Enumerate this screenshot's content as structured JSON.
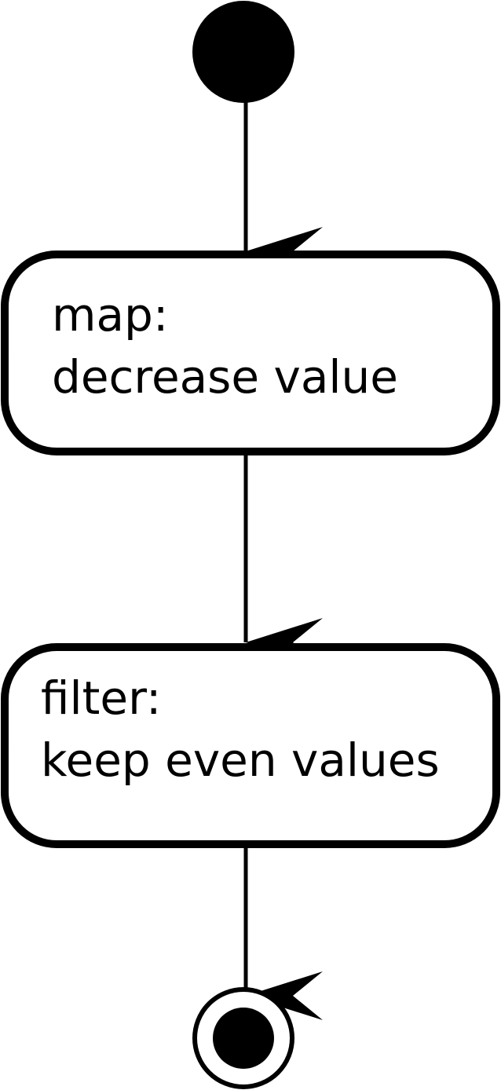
{
  "diagram": {
    "type": "activity",
    "colors": {
      "stroke": "#000000",
      "fill": "#ffffff",
      "node": "#000000"
    },
    "nodes": [
      {
        "id": "start",
        "kind": "initial-node"
      },
      {
        "id": "map",
        "kind": "action",
        "line1": "map:",
        "line2": "decrease value"
      },
      {
        "id": "filter",
        "kind": "action",
        "line1": "filter:",
        "line2": "keep even values"
      },
      {
        "id": "end",
        "kind": "final-node"
      }
    ],
    "edges": [
      {
        "from": "start",
        "to": "map"
      },
      {
        "from": "map",
        "to": "filter"
      },
      {
        "from": "filter",
        "to": "end"
      }
    ]
  }
}
